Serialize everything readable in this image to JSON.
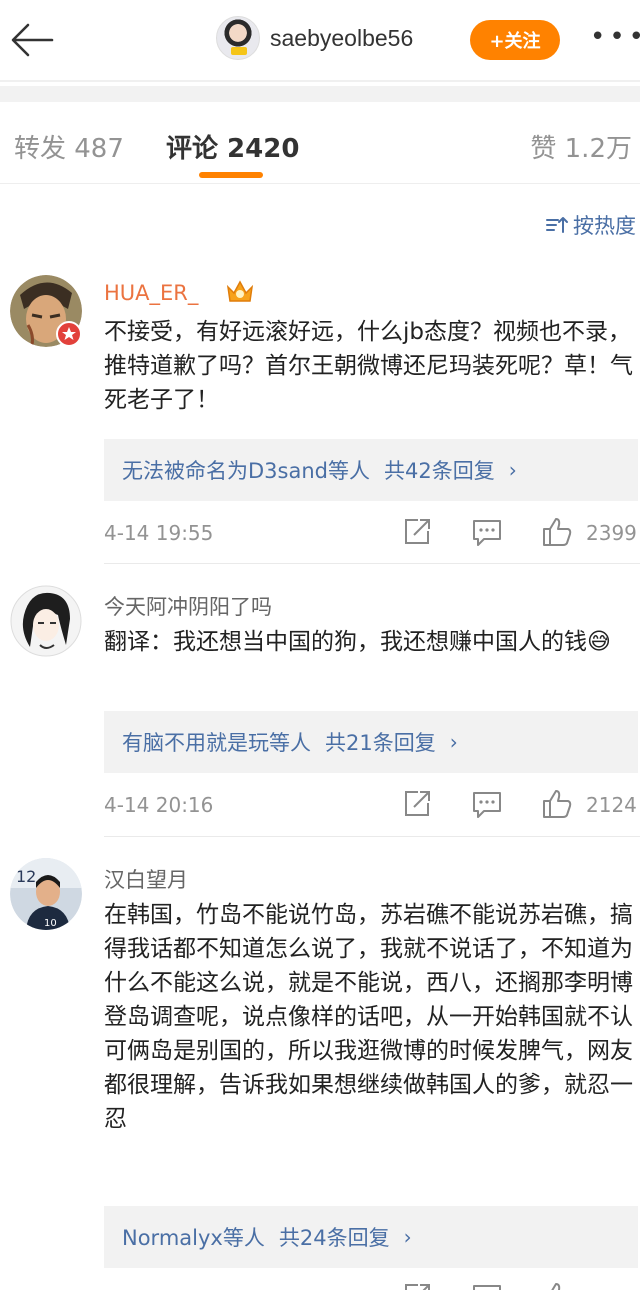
{
  "header": {
    "back_icon": "back-arrow-icon",
    "author_name": "saebyeolbe56",
    "follow_label": "+关注",
    "more_icon": "more-dots-icon",
    "more_label": "•••"
  },
  "tabs": {
    "forward": "转发 487",
    "comments": "评论 2420",
    "likes": "赞 1.2万"
  },
  "sort_label": "按热度",
  "colors": {
    "accent": "#ff8200",
    "link": "#4a6fa5",
    "vip_name": "#eb7340"
  },
  "comments": [
    {
      "name": "HUA_ER_",
      "badge": "crown-icon",
      "text": "不接受，有好远滚好远，什么jb态度？视频也不录，推特道歉了吗？首尔王朝微博还尼玛装死呢？草！气死老子了！",
      "reply_users": "无法被命名为D3sand等人",
      "reply_count": "共42条回复",
      "time": "4-14 19:55",
      "likes": "2399"
    },
    {
      "name": "今天阿冲阴阳了吗",
      "text": "翻译：我还想当中国的狗，我还想赚中国人的钱😅",
      "reply_users": "有脑不用就是玩等人",
      "reply_count": "共21条回复",
      "time": "4-14 20:16",
      "likes": "2124"
    },
    {
      "name": "汉白望月",
      "text": "在韩国，竹岛不能说竹岛，苏岩礁不能说苏岩礁，搞得我话都不知道怎么说了，我就不说话了，不知道为什么不能这么说，就是不能说，西八，还搁那李明博登岛调查呢，说点像样的话吧，从一开始韩国就不认可俩岛是别国的，所以我逛微博的时候发脾气，网友都很理解，告诉我如果想继续做韩国人的爹，就忍一忍",
      "reply_users": "Normalyx等人",
      "reply_count": "共24条回复"
    }
  ],
  "reply_chevron": "›"
}
